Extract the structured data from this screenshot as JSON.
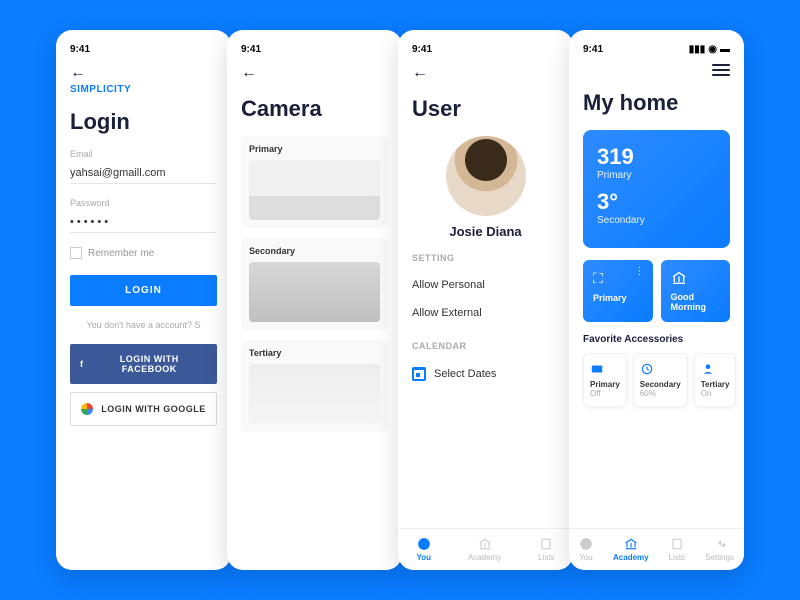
{
  "status_time": "9:41",
  "screen1": {
    "brand": "SIMPLICITY",
    "title": "Login",
    "email_label": "Email",
    "email_value": "yahsai@gmaill.com",
    "password_label": "Password",
    "password_value": "••••••",
    "remember_label": "Remember me",
    "login_btn": "LOGIN",
    "signup_hint": "You don't have a account? S",
    "fb_btn": "LOGIN WITH FACEBOOK",
    "gg_btn": "LOGIN WITH GOOGLE"
  },
  "screen2": {
    "title": "Camera",
    "cards": [
      "Primary",
      "Secondary",
      "Tertiary"
    ]
  },
  "screen3": {
    "title": "User",
    "name": "Josie Diana",
    "section_setting": "SETTING",
    "row1": "Allow Personal",
    "row2": "Allow External",
    "section_calendar": "CALENDAR",
    "row3": "Select Dates",
    "tabs": {
      "you": "You",
      "academy": "Academy",
      "lists": "Lists"
    }
  },
  "screen4": {
    "title": "My home",
    "big1_num": "319",
    "big1_sub": "Primary",
    "big2_num": "3°",
    "big2_sub": "Secondary",
    "tiles": {
      "primary": "Primary",
      "morning": "Good Morning"
    },
    "fav_title": "Favorite Accessories",
    "acc": [
      {
        "name": "Primary",
        "status": "Off"
      },
      {
        "name": "Secondary",
        "status": "60%"
      },
      {
        "name": "Tertiary",
        "status": "On"
      }
    ],
    "tabs": {
      "you": "You",
      "academy": "Academy",
      "lists": "Lists",
      "settings": "Settings"
    }
  }
}
